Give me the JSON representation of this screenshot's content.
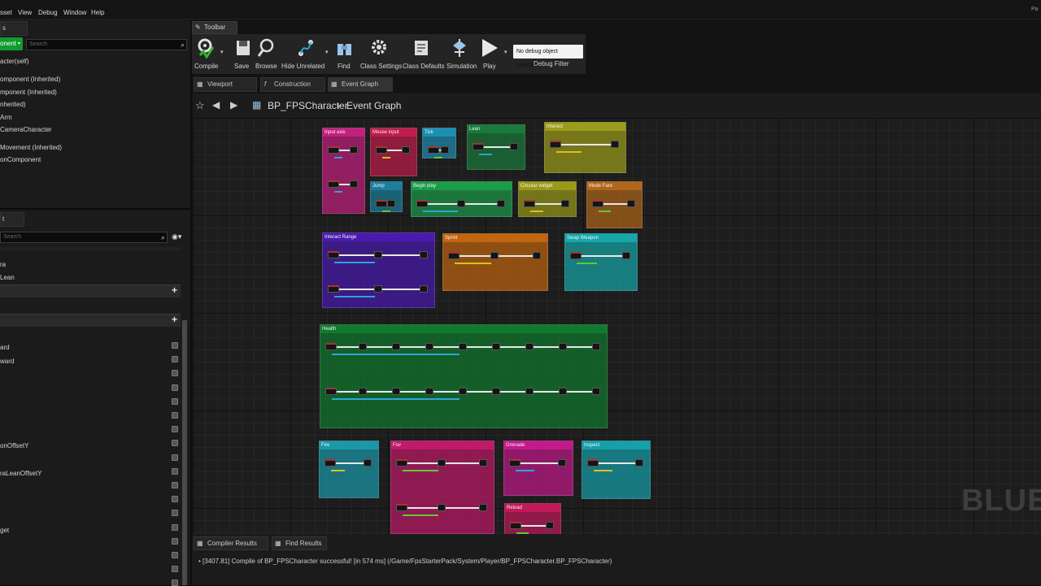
{
  "menu": [
    "sset",
    "View",
    "Debug",
    "Window",
    "Help"
  ],
  "corner_text": "Pa",
  "left_panel": {
    "tab1": "s",
    "add_button_label": "onent",
    "search_placeholder": "Search",
    "components": [
      "acter(self)",
      "omponent (Inherited)",
      "mponent (Inherited)",
      "nherited)",
      "Arm",
      "CameraCharacter",
      "Movement (Inherited)",
      "onComponent"
    ],
    "tab2": "t",
    "search2_placeholder": "Search",
    "list2": [
      "ra",
      "Lean"
    ],
    "variables": [
      "ard",
      "ward",
      "onOffsetY",
      "raLeanOffsetY",
      "get"
    ]
  },
  "toolbar": {
    "tab_label": "Toolbar",
    "buttons": [
      {
        "label": "Compile",
        "icon": "compile-icon"
      },
      {
        "label": "Save",
        "icon": "save-icon"
      },
      {
        "label": "Browse",
        "icon": "browse-icon"
      },
      {
        "label": "Hide Unrelated",
        "icon": "hide-unrelated-icon"
      },
      {
        "label": "Find",
        "icon": "find-icon"
      },
      {
        "label": "Class Settings",
        "icon": "class-settings-icon"
      },
      {
        "label": "Class Defaults",
        "icon": "class-defaults-icon"
      },
      {
        "label": "Simulation",
        "icon": "simulation-icon"
      },
      {
        "label": "Play",
        "icon": "play-icon"
      }
    ],
    "debug_select": "No debug object selected",
    "debug_label": "Debug Filter"
  },
  "doc_tabs": [
    "Viewport",
    "Construction Scrip",
    "Event Graph"
  ],
  "breadcrumb": {
    "blueprint": "BP_FPSCharacter",
    "graph": "Event Graph"
  },
  "comments": [
    {
      "label": "Input axis",
      "color": "#c2207e"
    },
    {
      "label": "Mouse input",
      "color": "#c01d4a"
    },
    {
      "label": "Tick",
      "color": "#1c8fb2"
    },
    {
      "label": "Lean",
      "color": "#1a7a3a"
    },
    {
      "label": "Interact",
      "color": "#9c9c1a"
    },
    {
      "label": "Jump",
      "color": "#1a7f9c"
    },
    {
      "label": "Begin play",
      "color": "#1c9c4a"
    },
    {
      "label": "Circular widget",
      "color": "#9a9a1a"
    },
    {
      "label": "Mode Fare",
      "color": "#b0661a"
    },
    {
      "label": "Interact Range",
      "color": "#4a1ab0"
    },
    {
      "label": "Sprint",
      "color": "#c2650e"
    },
    {
      "label": "Swap Weapon",
      "color": "#15a6aa"
    },
    {
      "label": "Health",
      "color": "#0f7a2e"
    },
    {
      "label": "Fire",
      "color": "#1a98a8"
    },
    {
      "label": "Fov",
      "color": "#c01a6a"
    },
    {
      "label": "Grenade",
      "color": "#c21a8a"
    },
    {
      "label": "Inspect",
      "color": "#15a0aa"
    },
    {
      "label": "Reload",
      "color": "#c01a5a"
    }
  ],
  "watermark": "BLUEPI",
  "bottom_tabs": [
    "Compiler Results",
    "Find Results"
  ],
  "log_line": "[3407.81] Compile of BP_FPSCharacter successful! [in 574 ms] (/Game/FpsStarterPack/System/Player/BP_FPSCharacter.BP_FPSCharacter)"
}
